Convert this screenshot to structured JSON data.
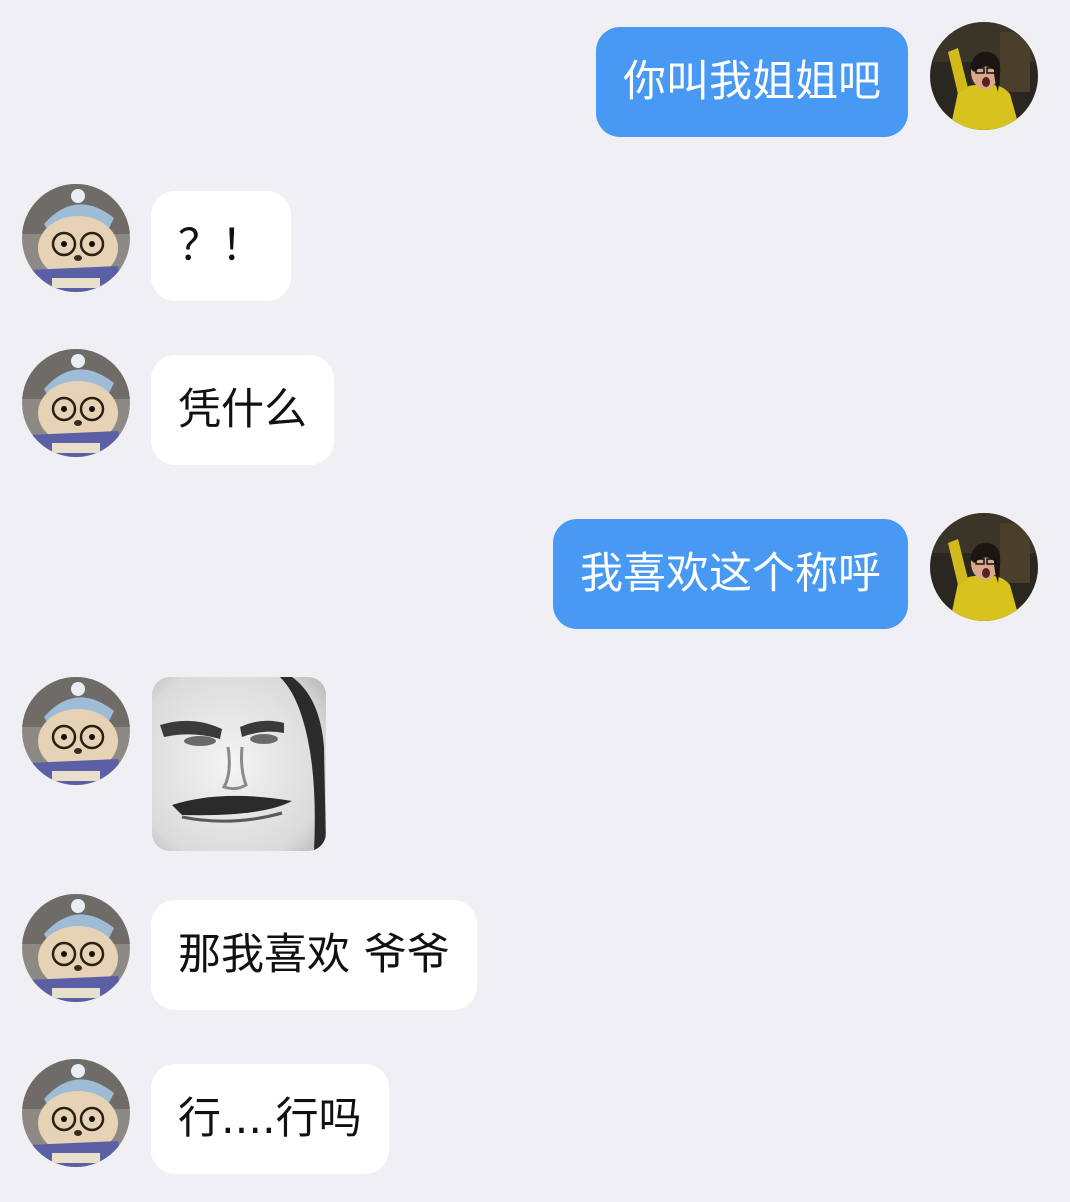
{
  "chat": {
    "messages": [
      {
        "side": "self",
        "type": "text",
        "text": "你叫我姐姐吧"
      },
      {
        "side": "other",
        "type": "text",
        "text": "？！"
      },
      {
        "side": "other",
        "type": "text",
        "text": "凭什么"
      },
      {
        "side": "self",
        "type": "text",
        "text": "我喜欢这个称呼"
      },
      {
        "side": "other",
        "type": "sticker",
        "text": ""
      },
      {
        "side": "other",
        "type": "text",
        "text": "那我喜欢 爷爷"
      },
      {
        "side": "other",
        "type": "text",
        "text": "行....行吗"
      }
    ],
    "colors": {
      "background": "#efeff4",
      "self_bubble": "#4799f3",
      "other_bubble": "#ffffff"
    },
    "icons": {
      "self_avatar": "woman-in-yellow-jacket-avatar",
      "other_avatar": "cat-with-glasses-avatar",
      "sticker": "grumpy-face-sticker"
    }
  }
}
